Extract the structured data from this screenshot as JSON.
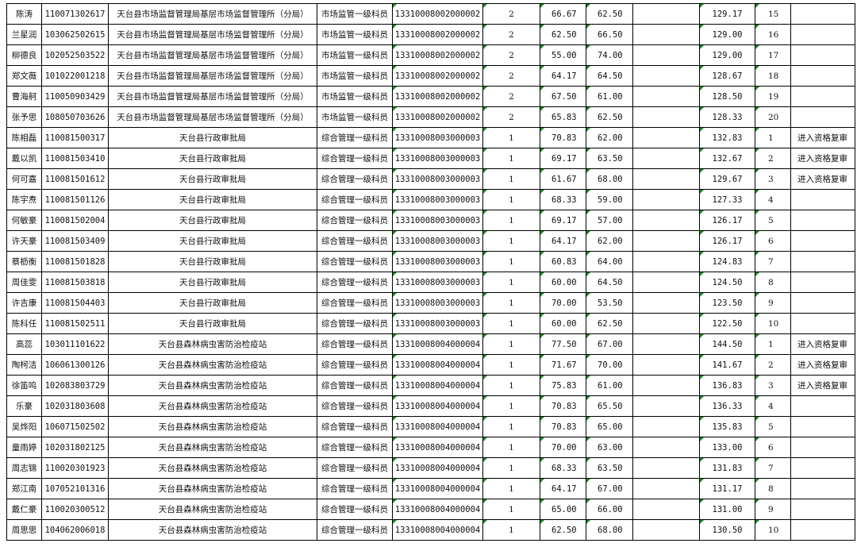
{
  "rows": [
    {
      "name": "陈涛",
      "id": "110071302617",
      "unit": "天台县市场监督管理局基层市场监督管理所（分局）",
      "post": "市场监管一级科员",
      "code": "13310008002000002",
      "num": "2",
      "s1": "66.67",
      "s2": "62.50",
      "bonus": "",
      "total": "129.17",
      "rank": "15",
      "note": ""
    },
    {
      "name": "兰星润",
      "id": "103062502615",
      "unit": "天台县市场监督管理局基层市场监督管理所（分局）",
      "post": "市场监管一级科员",
      "code": "13310008002000002",
      "num": "2",
      "s1": "62.50",
      "s2": "66.50",
      "bonus": "",
      "total": "129.00",
      "rank": "16",
      "note": ""
    },
    {
      "name": "柳德良",
      "id": "102052503522",
      "unit": "天台县市场监督管理局基层市场监督管理所（分局）",
      "post": "市场监管一级科员",
      "code": "13310008002000002",
      "num": "2",
      "s1": "55.00",
      "s2": "74.00",
      "bonus": "",
      "total": "129.00",
      "rank": "17",
      "note": ""
    },
    {
      "name": "郑文薇",
      "id": "101022001218",
      "unit": "天台县市场监督管理局基层市场监督管理所（分局）",
      "post": "市场监管一级科员",
      "code": "13310008002000002",
      "num": "2",
      "s1": "64.17",
      "s2": "64.50",
      "bonus": "",
      "total": "128.67",
      "rank": "18",
      "note": ""
    },
    {
      "name": "曹海舸",
      "id": "110050903429",
      "unit": "天台县市场监督管理局基层市场监督管理所（分局）",
      "post": "市场监管一级科员",
      "code": "13310008002000002",
      "num": "2",
      "s1": "67.50",
      "s2": "61.00",
      "bonus": "",
      "total": "128.50",
      "rank": "19",
      "note": ""
    },
    {
      "name": "张予思",
      "id": "108050703626",
      "unit": "天台县市场监督管理局基层市场监督管理所（分局）",
      "post": "市场监管一级科员",
      "code": "13310008002000002",
      "num": "2",
      "s1": "65.83",
      "s2": "62.50",
      "bonus": "",
      "total": "128.33",
      "rank": "20",
      "note": ""
    },
    {
      "name": "陈相磊",
      "id": "110081500317",
      "unit": "天台县行政审批局",
      "post": "综合管理一级科员",
      "code": "13310008003000003",
      "num": "1",
      "s1": "70.83",
      "s2": "62.00",
      "bonus": "",
      "total": "132.83",
      "rank": "1",
      "note": "进入资格复审"
    },
    {
      "name": "戴以凯",
      "id": "110081503410",
      "unit": "天台县行政审批局",
      "post": "综合管理一级科员",
      "code": "13310008003000003",
      "num": "1",
      "s1": "69.17",
      "s2": "63.50",
      "bonus": "",
      "total": "132.67",
      "rank": "2",
      "note": "进入资格复审"
    },
    {
      "name": "何可嘉",
      "id": "110081501612",
      "unit": "天台县行政审批局",
      "post": "综合管理一级科员",
      "code": "13310008003000003",
      "num": "1",
      "s1": "61.67",
      "s2": "68.00",
      "bonus": "",
      "total": "129.67",
      "rank": "3",
      "note": "进入资格复审"
    },
    {
      "name": "陈宇焘",
      "id": "110081501126",
      "unit": "天台县行政审批局",
      "post": "综合管理一级科员",
      "code": "13310008003000003",
      "num": "1",
      "s1": "68.33",
      "s2": "59.00",
      "bonus": "",
      "total": "127.33",
      "rank": "4",
      "note": ""
    },
    {
      "name": "何敏豪",
      "id": "110081502004",
      "unit": "天台县行政审批局",
      "post": "综合管理一级科员",
      "code": "13310008003000003",
      "num": "1",
      "s1": "69.17",
      "s2": "57.00",
      "bonus": "",
      "total": "126.17",
      "rank": "5",
      "note": ""
    },
    {
      "name": "许天豪",
      "id": "110081503409",
      "unit": "天台县行政审批局",
      "post": "综合管理一级科员",
      "code": "13310008003000003",
      "num": "1",
      "s1": "64.17",
      "s2": "62.00",
      "bonus": "",
      "total": "126.17",
      "rank": "6",
      "note": ""
    },
    {
      "name": "蔡枥衡",
      "id": "110081501828",
      "unit": "天台县行政审批局",
      "post": "综合管理一级科员",
      "code": "13310008003000003",
      "num": "1",
      "s1": "60.83",
      "s2": "64.00",
      "bonus": "",
      "total": "124.83",
      "rank": "7",
      "note": ""
    },
    {
      "name": "周佳雯",
      "id": "110081503818",
      "unit": "天台县行政审批局",
      "post": "综合管理一级科员",
      "code": "13310008003000003",
      "num": "1",
      "s1": "60.00",
      "s2": "64.50",
      "bonus": "",
      "total": "124.50",
      "rank": "8",
      "note": ""
    },
    {
      "name": "许吉康",
      "id": "110081504403",
      "unit": "天台县行政审批局",
      "post": "综合管理一级科员",
      "code": "13310008003000003",
      "num": "1",
      "s1": "70.00",
      "s2": "53.50",
      "bonus": "",
      "total": "123.50",
      "rank": "9",
      "note": ""
    },
    {
      "name": "陈科任",
      "id": "110081502511",
      "unit": "天台县行政审批局",
      "post": "综合管理一级科员",
      "code": "13310008003000003",
      "num": "1",
      "s1": "60.00",
      "s2": "62.50",
      "bonus": "",
      "total": "122.50",
      "rank": "10",
      "note": ""
    },
    {
      "name": "高蕊",
      "id": "103011101622",
      "unit": "天台县森林病虫害防治检疫站",
      "post": "综合管理一级科员",
      "code": "13310008004000004",
      "num": "1",
      "s1": "77.50",
      "s2": "67.00",
      "bonus": "",
      "total": "144.50",
      "rank": "1",
      "note": "进入资格复审"
    },
    {
      "name": "陶柯洁",
      "id": "106061300126",
      "unit": "天台县森林病虫害防治检疫站",
      "post": "综合管理一级科员",
      "code": "13310008004000004",
      "num": "1",
      "s1": "71.67",
      "s2": "70.00",
      "bonus": "",
      "total": "141.67",
      "rank": "2",
      "note": "进入资格复审"
    },
    {
      "name": "徐笛鸣",
      "id": "102083803729",
      "unit": "天台县森林病虫害防治检疫站",
      "post": "综合管理一级科员",
      "code": "13310008004000004",
      "num": "1",
      "s1": "75.83",
      "s2": "61.00",
      "bonus": "",
      "total": "136.83",
      "rank": "3",
      "note": "进入资格复审"
    },
    {
      "name": "乐豪",
      "id": "102031803608",
      "unit": "天台县森林病虫害防治检疫站",
      "post": "综合管理一级科员",
      "code": "13310008004000004",
      "num": "1",
      "s1": "70.83",
      "s2": "65.50",
      "bonus": "",
      "total": "136.33",
      "rank": "4",
      "note": ""
    },
    {
      "name": "吴烨阳",
      "id": "106071502502",
      "unit": "天台县森林病虫害防治检疫站",
      "post": "综合管理一级科员",
      "code": "13310008004000004",
      "num": "1",
      "s1": "70.83",
      "s2": "65.00",
      "bonus": "",
      "total": "135.83",
      "rank": "5",
      "note": ""
    },
    {
      "name": "童雨婷",
      "id": "102031802125",
      "unit": "天台县森林病虫害防治检疫站",
      "post": "综合管理一级科员",
      "code": "13310008004000004",
      "num": "1",
      "s1": "70.00",
      "s2": "63.00",
      "bonus": "",
      "total": "133.00",
      "rank": "6",
      "note": ""
    },
    {
      "name": "周志锦",
      "id": "110020301923",
      "unit": "天台县森林病虫害防治检疫站",
      "post": "综合管理一级科员",
      "code": "13310008004000004",
      "num": "1",
      "s1": "68.33",
      "s2": "63.50",
      "bonus": "",
      "total": "131.83",
      "rank": "7",
      "note": ""
    },
    {
      "name": "郑江南",
      "id": "107052101316",
      "unit": "天台县森林病虫害防治检疫站",
      "post": "综合管理一级科员",
      "code": "13310008004000004",
      "num": "1",
      "s1": "64.17",
      "s2": "67.00",
      "bonus": "",
      "total": "131.17",
      "rank": "8",
      "note": ""
    },
    {
      "name": "戴仁豪",
      "id": "110020300512",
      "unit": "天台县森林病虫害防治检疫站",
      "post": "综合管理一级科员",
      "code": "13310008004000004",
      "num": "1",
      "s1": "65.00",
      "s2": "66.00",
      "bonus": "",
      "total": "131.00",
      "rank": "9",
      "note": ""
    },
    {
      "name": "周思思",
      "id": "104062006018",
      "unit": "天台县森林病虫害防治检疫站",
      "post": "综合管理一级科员",
      "code": "13310008004000004",
      "num": "1",
      "s1": "62.50",
      "s2": "68.00",
      "bonus": "",
      "total": "130.50",
      "rank": "10",
      "note": ""
    }
  ]
}
